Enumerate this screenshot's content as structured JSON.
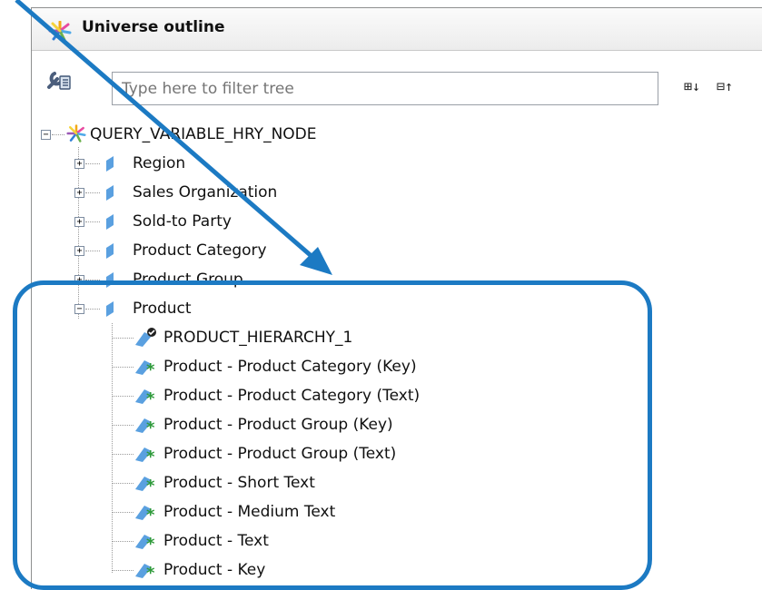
{
  "panel": {
    "title": "Universe outline",
    "filter_placeholder": "Type here to filter tree",
    "expand_all_label": "⊞↓",
    "collapse_all_label": "⊟↑"
  },
  "tree": {
    "root": "QUERY_VARIABLE_HRY_NODE",
    "dimensions": [
      {
        "label": "Region",
        "expanded": false
      },
      {
        "label": "Sales Organization",
        "expanded": false
      },
      {
        "label": "Sold-to Party",
        "expanded": false
      },
      {
        "label": "Product Category",
        "expanded": false
      },
      {
        "label": "Product Group",
        "expanded": false
      },
      {
        "label": "Product",
        "expanded": true
      }
    ],
    "product_children": {
      "hierarchy": "PRODUCT_HIERARCHY_1",
      "attributes": [
        "Product - Product Category (Key)",
        "Product - Product Category (Text)",
        "Product - Product Group (Key)",
        "Product - Product Group (Text)",
        "Product - Short Text",
        "Product - Medium Text",
        "Product - Text",
        "Product - Key"
      ]
    }
  },
  "colors": {
    "callout": "#1c7ac3",
    "dimension_icon": "#5aa0e0",
    "attribute_star": "#2e9a3a"
  }
}
